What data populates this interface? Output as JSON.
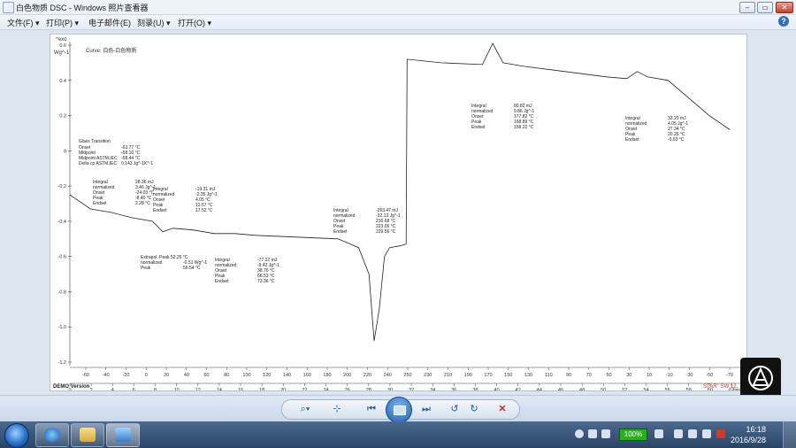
{
  "window": {
    "title": "白色物质 DSC - Windows 照片查看器"
  },
  "menu": [
    {
      "label": "文件(F)"
    },
    {
      "label": "打印(P)"
    },
    {
      "label": "电子邮件(E)"
    },
    {
      "label": "刻录(U)"
    },
    {
      "label": "打开(O)"
    }
  ],
  "chart": {
    "corner_label": "^exo",
    "y_unit_label": "Wg^-1",
    "curve_label": "Curve: 白色-白色物质",
    "y_ticks": [
      "0.6",
      "0.4",
      "0.2",
      "0",
      "-0.2",
      "-0.4",
      "-0.6",
      "-0.8",
      "-1.0",
      "-1.2"
    ],
    "temp_ticks": [
      "-60",
      "-40",
      "-20",
      "0",
      "20",
      "40",
      "60",
      "80",
      "100",
      "120",
      "140",
      "160",
      "180",
      "200",
      "220",
      "240",
      "250",
      "230",
      "210",
      "190",
      "170",
      "150",
      "130",
      "110",
      "90",
      "70",
      "50",
      "30",
      "10",
      "-10",
      "-30",
      "-50",
      "-70"
    ],
    "time_ticks": [
      "0",
      "2",
      "4",
      "6",
      "8",
      "10",
      "12",
      "14",
      "16",
      "18",
      "20",
      "22",
      "24",
      "26",
      "28",
      "30",
      "32",
      "34",
      "36",
      "38",
      "40",
      "42",
      "44",
      "46",
      "48",
      "50",
      "52",
      "54",
      "56",
      "58",
      "60",
      "62"
    ],
    "time_unit": "min",
    "footer_left": "DEMO Version",
    "footer_right": "STAR° SW 12."
  },
  "chart_data": {
    "type": "line",
    "title": "Curve: 白色-白色物质",
    "ylabel": "Wg^-1",
    "ylim": [
      -1.2,
      0.6
    ],
    "series": [
      {
        "x": [
          0,
          2,
          4,
          6,
          8,
          9,
          10,
          12,
          14,
          16,
          18,
          22,
          26,
          28,
          29,
          29.5,
          30,
          30.5,
          31,
          32,
          32.6,
          32.7,
          36,
          40,
          41,
          42,
          44,
          48,
          52,
          54,
          55,
          56,
          58,
          60,
          62,
          64
        ],
        "y": [
          -0.25,
          -0.33,
          -0.35,
          -0.38,
          -0.4,
          -0.46,
          -0.44,
          -0.45,
          -0.47,
          -0.47,
          -0.48,
          -0.49,
          -0.5,
          -0.55,
          -0.7,
          -1.08,
          -0.9,
          -0.6,
          -0.55,
          -0.54,
          -0.53,
          0.52,
          0.5,
          0.49,
          0.61,
          0.5,
          0.48,
          0.45,
          0.42,
          0.41,
          0.45,
          0.42,
          0.4,
          0.3,
          0.2,
          0.12
        ]
      }
    ],
    "annotations": [
      {
        "heading": "Glass Transition",
        "rows": [
          [
            "Onset",
            "-63.77 °C"
          ],
          [
            "Midpoint",
            "-58.16 °C"
          ],
          [
            "Midpoint ASTM,IEC",
            "-58.44 °C"
          ],
          [
            "Delta cp ASTM,IEC",
            "0.143 Jg^-1K^-1"
          ]
        ]
      },
      {
        "rows": [
          [
            "Integral",
            "28.36 mJ"
          ],
          [
            "  normalized",
            "3.46 Jg^-1"
          ],
          [
            "Onset",
            "-24.03 °C"
          ],
          [
            "Peak",
            "-8.40 °C"
          ],
          [
            "Endset",
            "2.28 °C"
          ]
        ]
      },
      {
        "rows": [
          [
            "Integral",
            "-19.31 mJ"
          ],
          [
            "  normalized",
            "-2.35 Jg^-1"
          ],
          [
            "Onset",
            "4.05 °C"
          ],
          [
            "Peak",
            "12.57 °C"
          ],
          [
            "Endset",
            "17.52 °C"
          ]
        ]
      },
      {
        "rows": [
          [
            "Extrapol. Peak 52.25 °C",
            ""
          ],
          [
            "  normalized",
            "-0.51 Wg^-1"
          ],
          [
            "Peak",
            "56.54 °C"
          ]
        ]
      },
      {
        "rows": [
          [
            "Integral",
            "-77.22 mJ"
          ],
          [
            "  normalized",
            "-9.42 Jg^-1"
          ],
          [
            "Onset",
            "38.76 °C"
          ],
          [
            "Peak",
            "66.53 °C"
          ],
          [
            "Endset",
            "73.36 °C"
          ]
        ]
      },
      {
        "rows": [
          [
            "Integral",
            "-263.47 mJ"
          ],
          [
            "  normalized",
            "-32.13 Jg^-1"
          ],
          [
            "Onset",
            "216.68 °C"
          ],
          [
            "Peak",
            "223.06 °C"
          ],
          [
            "Endset",
            "229.56 °C"
          ]
        ]
      },
      {
        "rows": [
          [
            "Integral",
            "80.82 mJ"
          ],
          [
            "  normalized",
            "9.86 Jg^-1"
          ],
          [
            "Onset",
            "177.82 °C"
          ],
          [
            "Peak",
            "168.89 °C"
          ],
          [
            "Endset",
            "158.22 °C"
          ]
        ]
      },
      {
        "rows": [
          [
            "Integral",
            "33.20 mJ"
          ],
          [
            "  normalized",
            "4.05 Jg^-1"
          ],
          [
            "Onset",
            "27.34 °C"
          ],
          [
            "Peak",
            "20.26 °C"
          ],
          [
            "Endset",
            "-0.63 °C"
          ]
        ]
      }
    ]
  },
  "toolbar": {
    "zoom_icon": "magnifier-icon",
    "fit_icon": "fit-window-icon",
    "prev_icon": "previous-icon",
    "slideshow_icon": "slideshow-icon",
    "next_icon": "next-icon",
    "rotate_ccw_icon": "rotate-counterclockwise-icon",
    "rotate_cw_icon": "rotate-clockwise-icon",
    "delete_icon": "delete-icon"
  },
  "taskbar": {
    "battery": "100%",
    "time": "16:18",
    "date": "2016/9/28"
  },
  "colors": {
    "accent": "#2f6fbd",
    "delete": "#d22a2a",
    "battery": "#27b11d"
  }
}
